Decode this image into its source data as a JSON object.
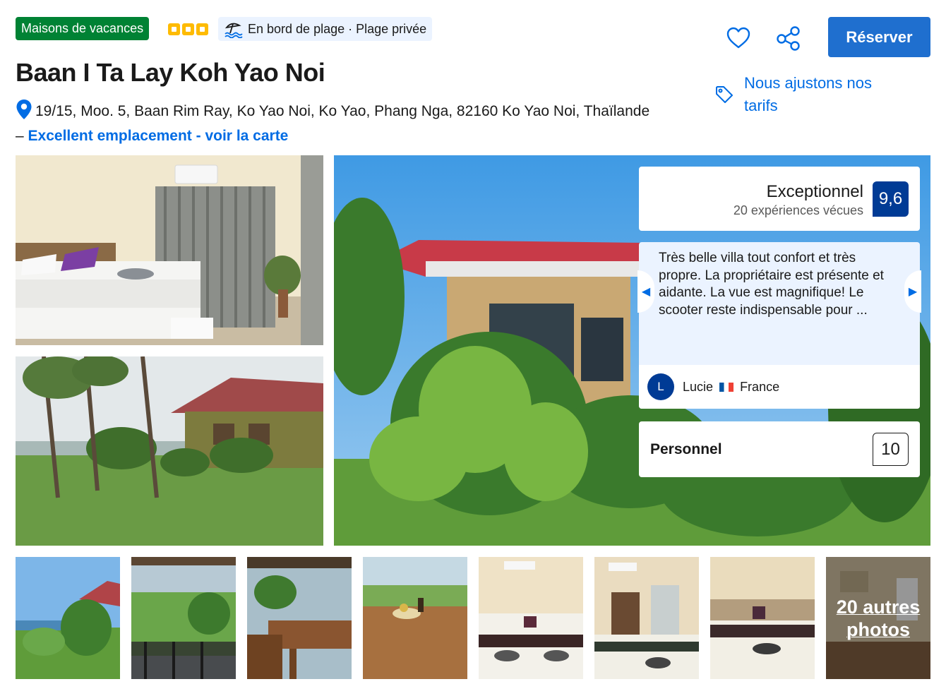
{
  "header": {
    "property_type": "Maisons de vacances",
    "star_rating": 3,
    "beach_tag": "En bord de plage · Plage privée",
    "title": "Baan I Ta Lay Koh Yao Noi",
    "address": "19/15, Moo. 5, Baan Rim Ray, Ko Yao Noi, Ko Yao, Phang Nga, 82160 Ko Yao Noi, Thaïlande",
    "address_separator": "–",
    "map_link": "Excellent emplacement - voir la carte"
  },
  "actions": {
    "favorite_icon": "heart-icon",
    "share_icon": "share-icon",
    "reserve_label": "Réserver",
    "price_note": "Nous ajustons nos tarifs",
    "price_icon": "tag-icon"
  },
  "rating": {
    "label": "Exceptionnel",
    "reviews_count": "20 expériences vécues",
    "score": "9,6"
  },
  "review": {
    "text": "Très belle villa tout confort et très propre. La propriétaire est présente et aidante. La vue est magnifique! Le scooter reste indispensable pour ...",
    "author_initial": "L",
    "author_name": "Lucie",
    "author_country": "France"
  },
  "staff": {
    "label": "Personnel",
    "score": "10"
  },
  "gallery": {
    "more_photos": "20 autres photos"
  },
  "colors": {
    "brand_blue": "#006ce4",
    "dark_blue": "#003b95",
    "green": "#008234",
    "star_yellow": "#febb02",
    "button_blue": "#1f6fcf"
  }
}
